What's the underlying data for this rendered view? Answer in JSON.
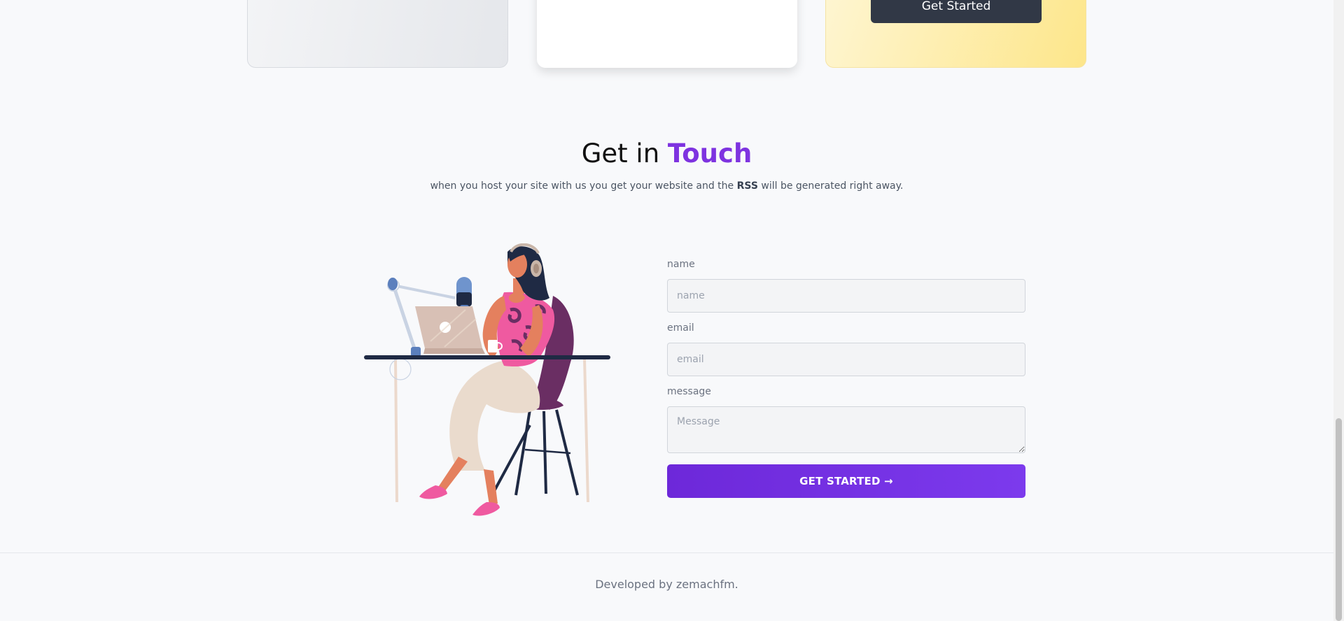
{
  "pricing": {
    "cta_label": "Get Started"
  },
  "contact": {
    "title_prefix": "Get in ",
    "title_accent": "Touch",
    "subtitle_before": "when you host your site with us you get your website and the ",
    "subtitle_bold": "RSS",
    "subtitle_after": " will be generated right away.",
    "name_label": "name",
    "name_placeholder": "name",
    "email_label": "email",
    "email_placeholder": "email",
    "message_label": "message",
    "message_placeholder": "Message",
    "submit_label": "GET STARTED →"
  },
  "footer": {
    "text": "Developed by zemachfm."
  },
  "colors": {
    "accent": "#7e33e0",
    "button": "#6d28d9",
    "dark_button": "#313846"
  },
  "icons": {
    "illustration": "woman-podcasting-illustration"
  }
}
